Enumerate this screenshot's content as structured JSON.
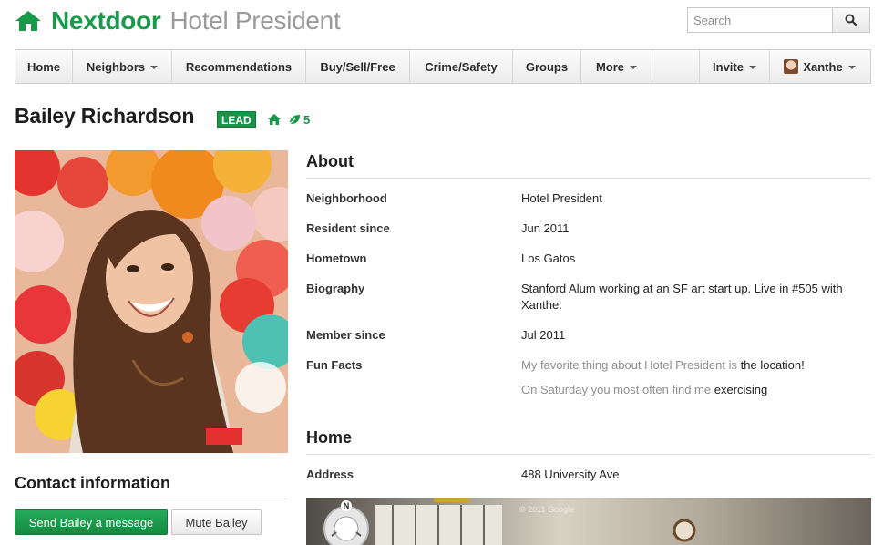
{
  "brand": {
    "name": "Nextdoor",
    "community": "Hotel President",
    "icon": "house-icon"
  },
  "search": {
    "placeholder": "Search",
    "icon": "search-icon"
  },
  "nav": {
    "home": "Home",
    "neighbors": "Neighbors",
    "recommendations": "Recommendations",
    "buysell": "Buy/Sell/Free",
    "crime": "Crime/Safety",
    "groups": "Groups",
    "more": "More",
    "invite": "Invite",
    "user": "Xanthe"
  },
  "profile": {
    "name": "Bailey Richardson",
    "badge": "LEAD",
    "leaf_count": "5"
  },
  "contact": {
    "title": "Contact information",
    "message_button": "Send Bailey a message",
    "mute_button": "Mute Bailey"
  },
  "about": {
    "title": "About",
    "neighborhood_label": "Neighborhood",
    "neighborhood_value": "Hotel President",
    "resident_label": "Resident since",
    "resident_value": "Jun 2011",
    "hometown_label": "Hometown",
    "hometown_value": "Los Gatos",
    "bio_label": "Biography",
    "bio_value": "Stanford Alum working at an SF art start up. Live in #505 with Xanthe.",
    "member_label": "Member since",
    "member_value": "Jul 2011",
    "fun_label": "Fun Facts",
    "fun1_prompt": "My favorite thing about Hotel President is",
    "fun1_answer": "the location!",
    "fun2_prompt": "On Saturday you most often find me",
    "fun2_answer": "exercising"
  },
  "home": {
    "title": "Home",
    "address_label": "Address",
    "address_value": "488 University Ave",
    "map_compass": "N",
    "map_copyright": "© 2011 Google"
  },
  "colors": {
    "brand_green": "#199a4b",
    "muted_gray": "#9a9a9a"
  }
}
